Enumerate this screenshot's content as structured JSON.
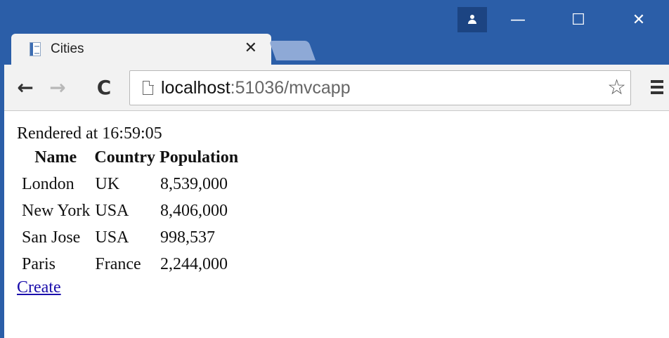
{
  "window": {
    "controls": {
      "minimize": "—",
      "maximize": "☐",
      "close": "✕"
    }
  },
  "tab": {
    "title": "Cities",
    "close": "✕"
  },
  "toolbar": {
    "back": "←",
    "forward": "→",
    "reload": "C",
    "url_host": "localhost",
    "url_rest": ":51036/mvcapp",
    "bookmark": "☆"
  },
  "page": {
    "rendered_text": "Rendered at 16:59:05",
    "table": {
      "headers": [
        "Name",
        "Country",
        "Population"
      ],
      "rows": [
        [
          "London",
          "UK",
          "8,539,000"
        ],
        [
          "New York",
          "USA",
          "8,406,000"
        ],
        [
          "San Jose",
          "USA",
          "998,537"
        ],
        [
          "Paris",
          "France",
          "2,244,000"
        ]
      ]
    },
    "create_link": "Create"
  },
  "colors": {
    "titlebar": "#2b5ea8",
    "toolbar": "#f2f2f2",
    "link": "#1a0dab"
  }
}
